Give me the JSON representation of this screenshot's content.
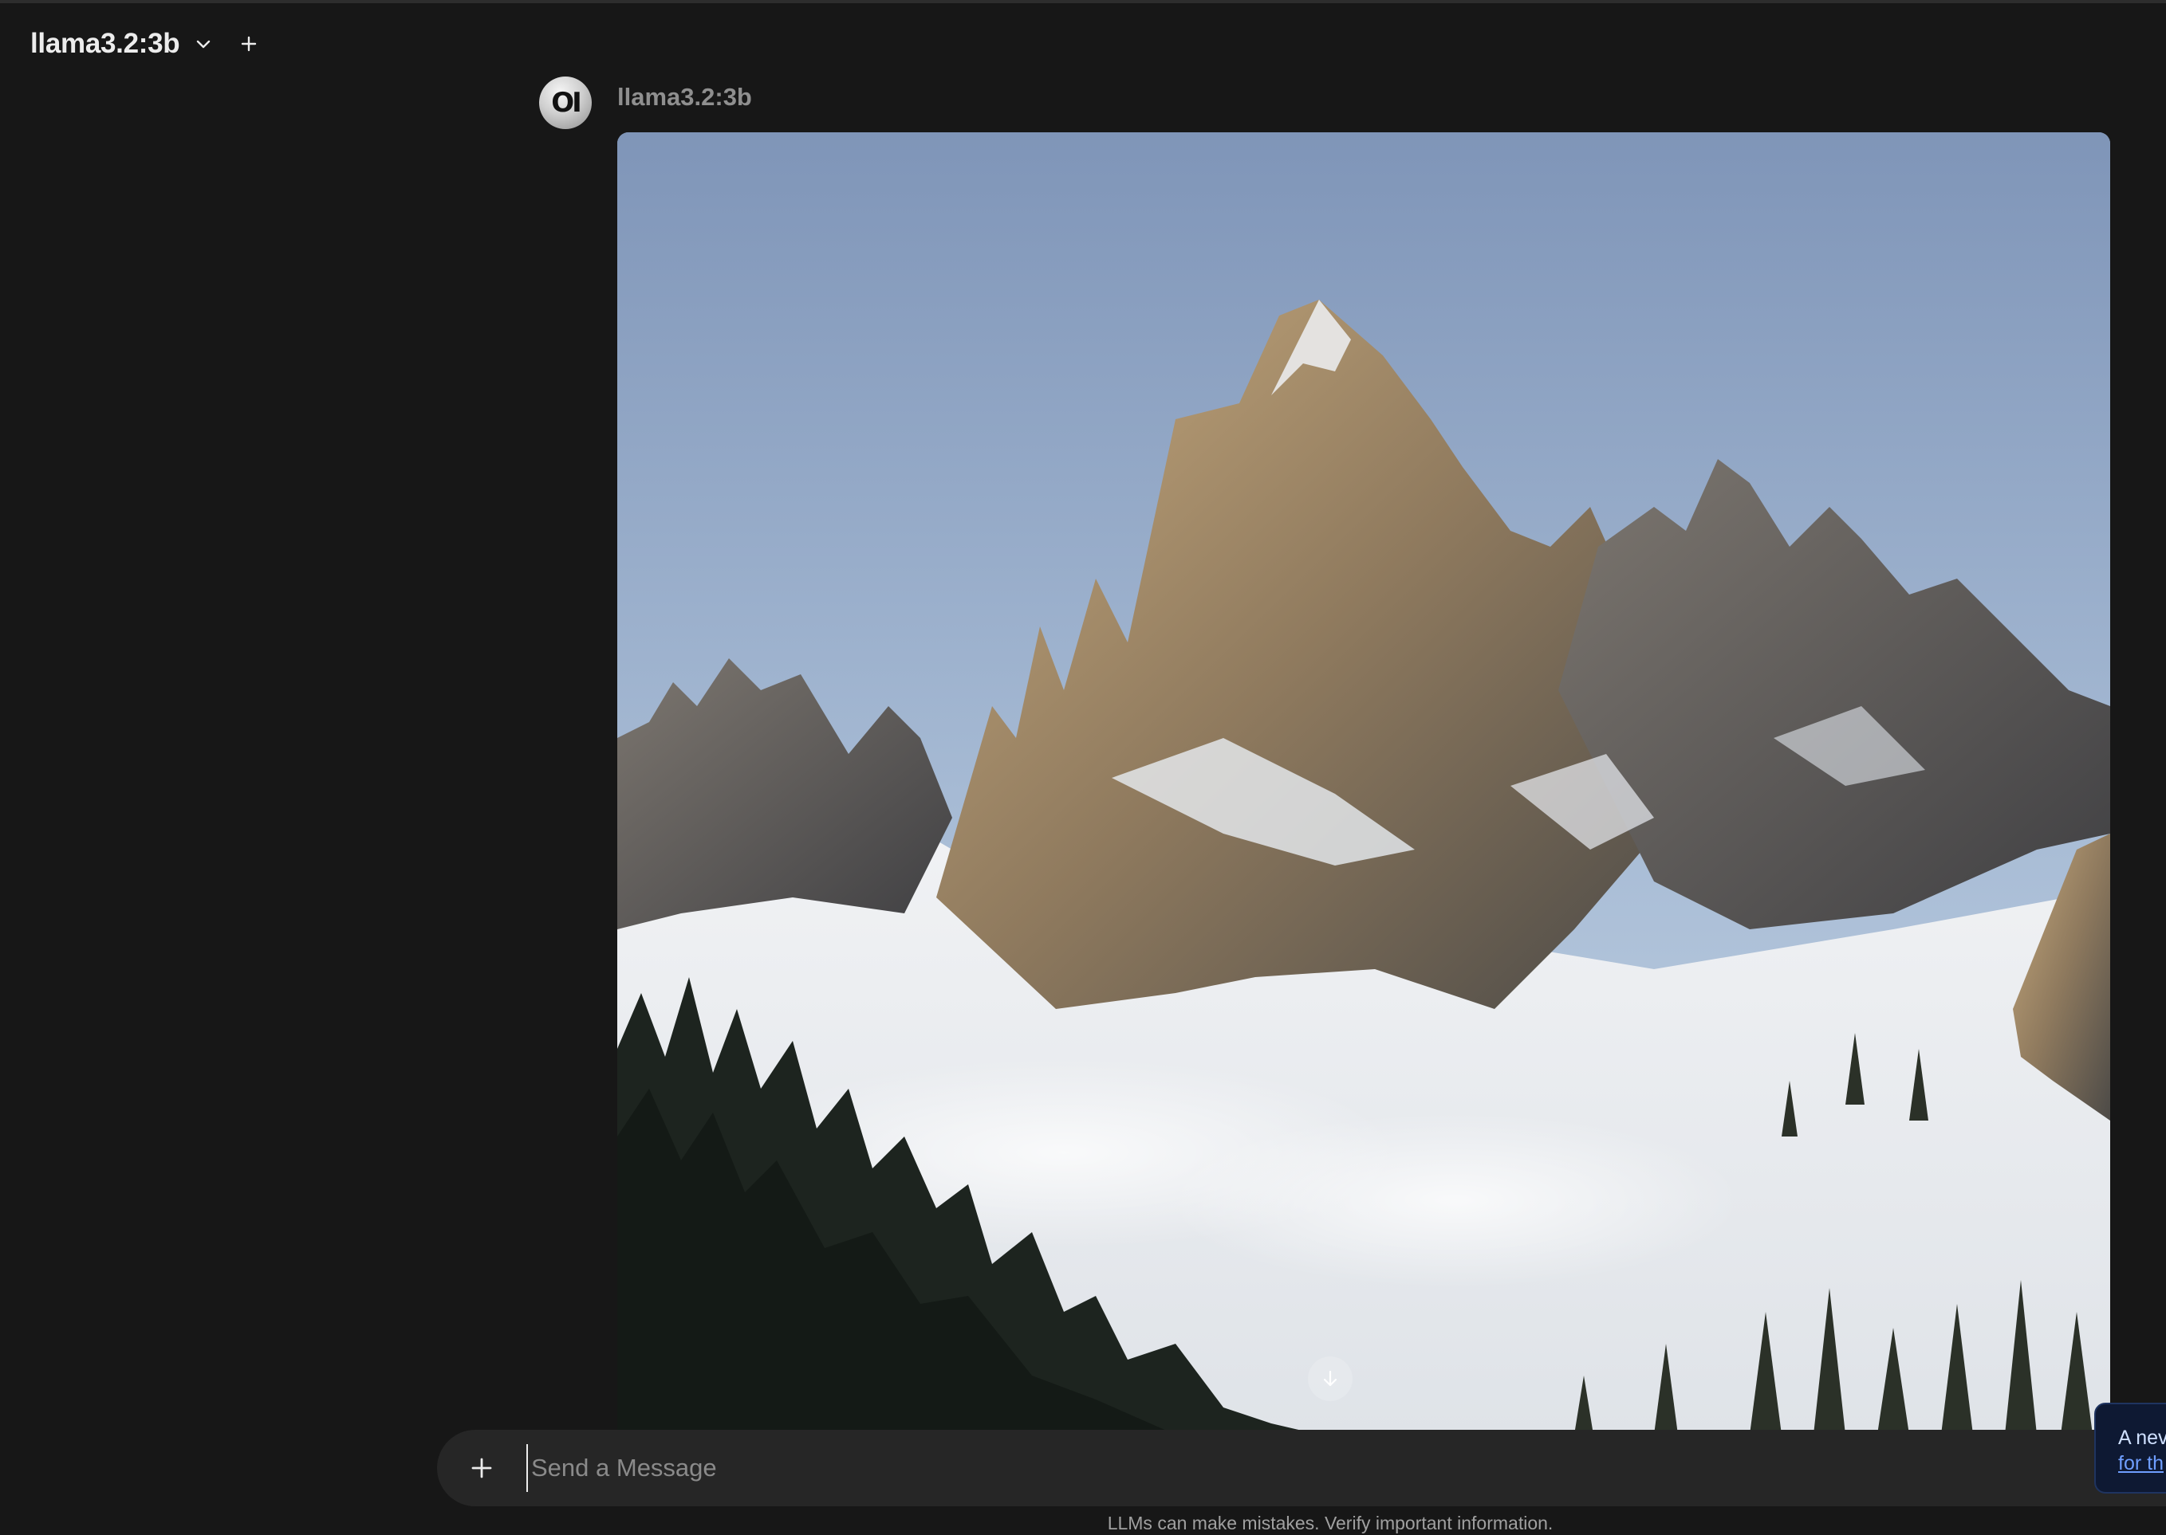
{
  "header": {
    "model_name": "llama3.2:3b",
    "dropdown_icon": "chevron-down-icon",
    "new_chat_icon": "plus-icon"
  },
  "message": {
    "sender": "llama3.2:3b",
    "avatar_text": "OI",
    "image_subject": "snowy-rocky-mountain-peak"
  },
  "scroll_button_icon": "arrow-down-icon",
  "composer": {
    "attach_icon": "plus-icon",
    "placeholder": "Send a Message"
  },
  "disclaimer": "LLMs can make mistakes. Verify important information.",
  "toast": {
    "line1": "A nev",
    "line2": "for th"
  },
  "colors": {
    "background": "#171717",
    "composer": "#262626",
    "toast_bg": "#0e1933",
    "link": "#6f9eff"
  }
}
